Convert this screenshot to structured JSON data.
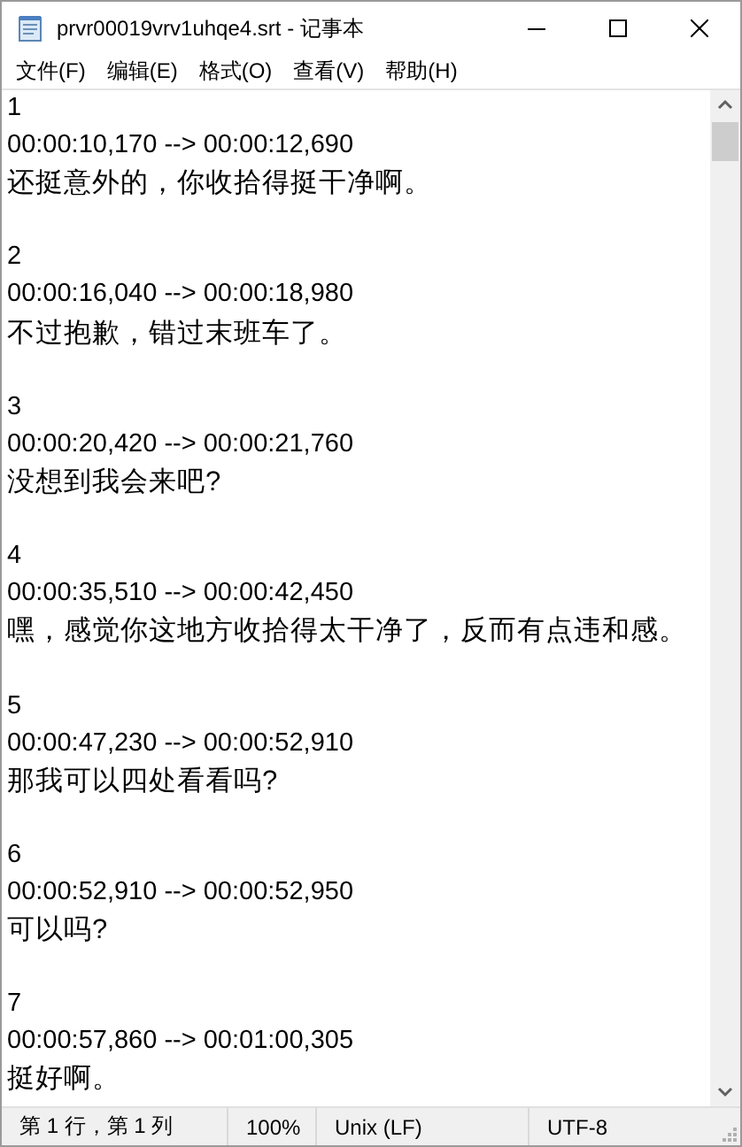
{
  "window": {
    "title": "prvr00019vrv1uhqe4.srt - 记事本"
  },
  "menu": [
    "文件(F)",
    "编辑(E)",
    "格式(O)",
    "查看(V)",
    "帮助(H)"
  ],
  "entries": [
    {
      "index": "1",
      "time": "00:00:10,170 --> 00:00:12,690",
      "text": "还挺意外的，你收拾得挺干净啊。"
    },
    {
      "index": "2",
      "time": "00:00:16,040 --> 00:00:18,980",
      "text": "不过抱歉，错过末班车了。"
    },
    {
      "index": "3",
      "time": "00:00:20,420 --> 00:00:21,760",
      "text": "没想到我会来吧?"
    },
    {
      "index": "4",
      "time": "00:00:35,510 --> 00:00:42,450",
      "text": "嘿，感觉你这地方收拾得太干净了，反而有点违和感。"
    },
    {
      "index": "5",
      "time": "00:00:47,230 --> 00:00:52,910",
      "text": "那我可以四处看看吗?"
    },
    {
      "index": "6",
      "time": "00:00:52,910 --> 00:00:52,950",
      "text": "可以吗?"
    },
    {
      "index": "7",
      "time": "00:00:57,860 --> 00:01:00,305",
      "text": "挺好啊。"
    }
  ],
  "status_bar": [
    "第 1 行，第 1 列",
    "100%",
    "Unix (LF)",
    "UTF-8"
  ]
}
